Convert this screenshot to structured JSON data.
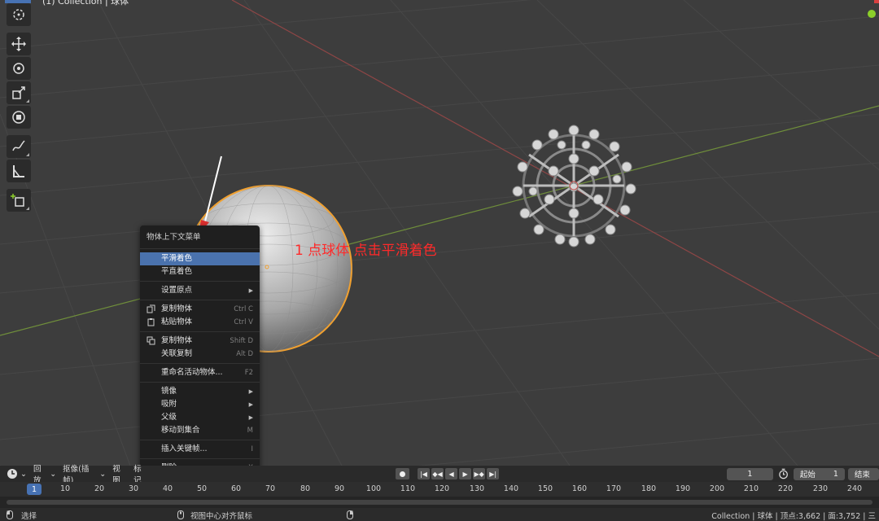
{
  "viewport": {
    "header_text": "(1) Collection | 球体"
  },
  "annotation": "1 点球体  点击平滑着色",
  "context_menu": {
    "title": "物体上下文菜单",
    "items": [
      {
        "label": "平滑着色",
        "shortcut": "",
        "submenu": false,
        "highlight": true
      },
      {
        "label": "平直着色",
        "shortcut": "",
        "submenu": false
      },
      {
        "sep": true
      },
      {
        "label": "设置原点",
        "shortcut": "",
        "submenu": true
      },
      {
        "sep": true
      },
      {
        "label": "复制物体",
        "shortcut": "Ctrl C",
        "icon": "copy-icon"
      },
      {
        "label": "粘贴物体",
        "shortcut": "Ctrl V",
        "icon": "paste-icon"
      },
      {
        "sep": true
      },
      {
        "label": "复制物体",
        "shortcut": "Shift D",
        "icon": "duplicate-icon"
      },
      {
        "label": "关联复制",
        "shortcut": "Alt D"
      },
      {
        "sep": true
      },
      {
        "label": "重命名活动物体...",
        "shortcut": "F2"
      },
      {
        "sep": true
      },
      {
        "label": "镜像",
        "submenu": true
      },
      {
        "label": "吸附",
        "submenu": true
      },
      {
        "label": "父级",
        "submenu": true
      },
      {
        "label": "移动到集合",
        "shortcut": "M"
      },
      {
        "sep": true
      },
      {
        "label": "插入关键帧...",
        "shortcut": "I"
      },
      {
        "sep": true
      },
      {
        "label": "删除",
        "shortcut": "X"
      }
    ]
  },
  "timeline": {
    "menus": [
      "回放",
      "抠像(插帧)",
      "视图",
      "标记"
    ],
    "current_frame": "1",
    "start_label": "起始",
    "start_value": "1",
    "end_label": "结束",
    "ruler": [
      "1",
      "10",
      "20",
      "30",
      "40",
      "50",
      "60",
      "70",
      "80",
      "90",
      "100",
      "110",
      "120",
      "130",
      "140",
      "150",
      "160",
      "170",
      "180",
      "190",
      "200",
      "210",
      "220",
      "230",
      "240"
    ]
  },
  "statusbar": {
    "left": "选择",
    "middle": "视图中心对齐鼠标",
    "right": "Collection | 球体 | 顶点:3,662 | 面:3,752 | 三"
  },
  "colors": {
    "accent": "#4772b3",
    "selection": "#f0a030",
    "annotation": "#ff2a2a"
  }
}
